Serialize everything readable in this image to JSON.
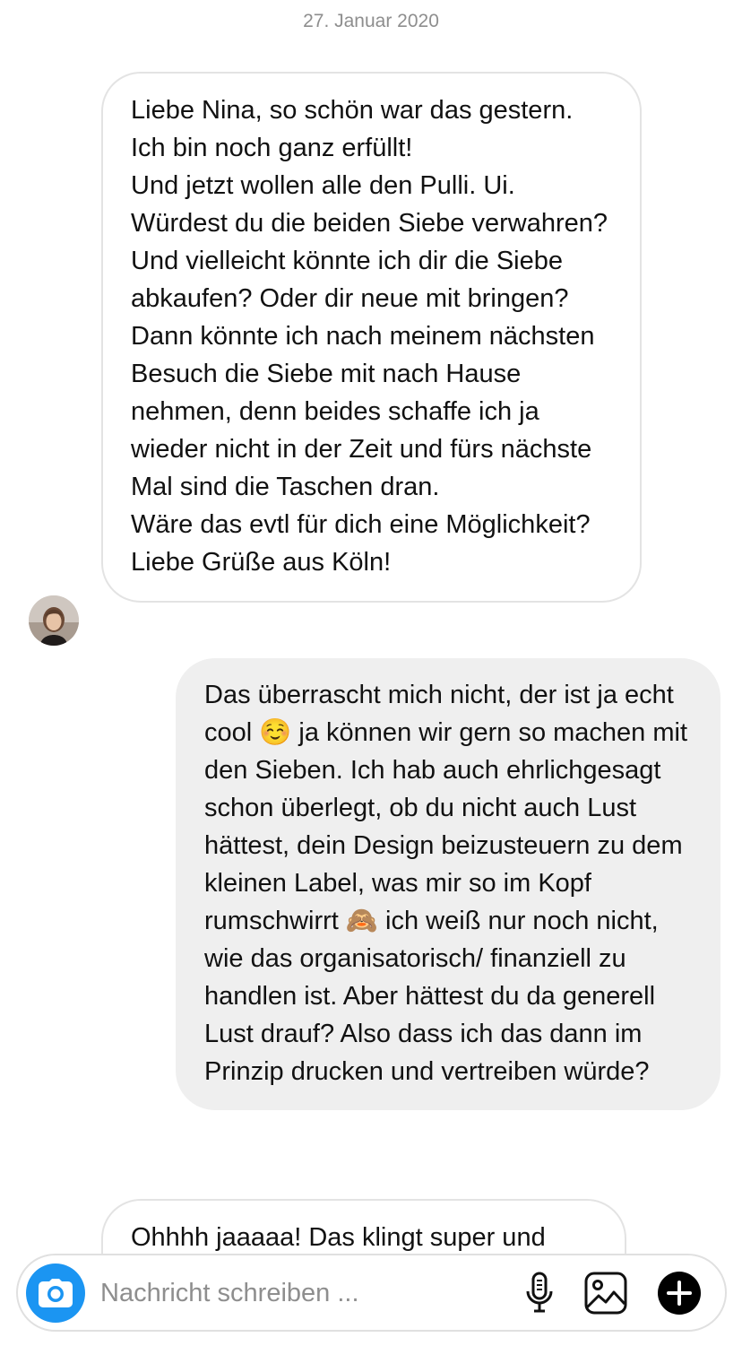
{
  "thread": {
    "date_label": "27. Januar 2020",
    "messages": [
      {
        "direction": "incoming",
        "text": "Liebe Nina, so schön war das gestern. Ich bin noch ganz erfüllt!\nUnd jetzt wollen alle den   Pulli. Ui. Würdest du die beiden Siebe verwahren? Und vielleicht könnte ich dir die Siebe abkaufen? Oder dir neue mit bringen? Dann könnte ich nach meinem nächsten Besuch die Siebe mit nach Hause nehmen, denn beides schaffe ich ja wieder nicht in der Zeit und fürs nächste Mal sind die Taschen dran.\nWäre das evtl für dich eine Möglichkeit? Liebe Grüße aus Köln!"
      },
      {
        "direction": "outgoing",
        "text": "Das überrascht mich nicht, der ist ja echt cool ☺️ ja können wir gern so machen mit den Sieben. Ich hab auch ehrlichgesagt schon überlegt, ob du nicht auch Lust hättest, dein Design beizusteuern zu dem kleinen Label, was mir so im Kopf rumschwirrt 🙈 ich weiß nur noch nicht, wie das organisatorisch/ finanziell zu handlen ist. Aber hättest du da generell Lust drauf? Also dass ich das dann im Prinzip drucken und vertreiben würde?"
      },
      {
        "direction": "incoming",
        "text": "Ohhhh jaaaaa! Das klingt super und"
      }
    ]
  },
  "composer": {
    "placeholder": "Nachricht schreiben ...",
    "value": "",
    "icons": {
      "camera": "camera-icon",
      "microphone": "microphone-icon",
      "gallery": "image-gallery-icon",
      "add": "plus-icon"
    }
  },
  "colors": {
    "camera_button": "#1b95f2",
    "outgoing_bubble": "#efefef",
    "incoming_border": "#e3e3e3",
    "meta_text": "#8e8e8e"
  }
}
